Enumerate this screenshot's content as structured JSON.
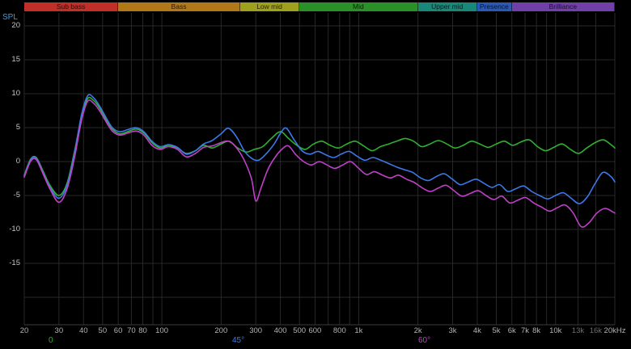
{
  "header": {
    "spl_label": "SPL"
  },
  "bands": [
    {
      "label": "Sub bass",
      "color": "#c03028",
      "from": 20,
      "to": 60
    },
    {
      "label": "Bass",
      "color": "#b07818",
      "from": 60,
      "to": 250
    },
    {
      "label": "Low mid",
      "color": "#9ea01e",
      "from": 250,
      "to": 500
    },
    {
      "label": "Mid",
      "color": "#2a9028",
      "from": 500,
      "to": 2000
    },
    {
      "label": "Upper mid",
      "color": "#198878",
      "from": 2000,
      "to": 4000
    },
    {
      "label": "Presence",
      "color": "#2a58b8",
      "from": 4000,
      "to": 6000
    },
    {
      "label": "Brilliance",
      "color": "#7040a8",
      "from": 6000,
      "to": 20000
    }
  ],
  "legend": [
    {
      "label": "0",
      "color": "#30b030"
    },
    {
      "label": "45°",
      "color": "#3c78e8"
    },
    {
      "label": "60°",
      "color": "#c040c8"
    }
  ],
  "chart_data": {
    "type": "line",
    "title": "",
    "xlabel": "",
    "ylabel": "SPL",
    "x_scale": "log",
    "xlim": [
      20,
      20000
    ],
    "ylim": [
      -24,
      20
    ],
    "grid": true,
    "grid_color": "#282828",
    "axis_line_color": "#3c3c3c",
    "y_ticks": [
      20,
      15,
      10,
      5,
      0,
      -5,
      -10,
      -15
    ],
    "grid_dbs": [
      20,
      15,
      10,
      5,
      0,
      -5,
      -10,
      -15,
      -20
    ],
    "grid_freqs": [
      20,
      30,
      40,
      50,
      60,
      70,
      80,
      90,
      100,
      200,
      300,
      400,
      500,
      600,
      700,
      800,
      900,
      1000,
      2000,
      3000,
      4000,
      5000,
      6000,
      7000,
      8000,
      9000,
      10000,
      13000,
      16000,
      20000
    ],
    "x_ticks": [
      {
        "f": 20,
        "label": "20"
      },
      {
        "f": 30,
        "label": "30"
      },
      {
        "f": 40,
        "label": "40"
      },
      {
        "f": 50,
        "label": "50"
      },
      {
        "f": 60,
        "label": "60"
      },
      {
        "f": 70,
        "label": "70"
      },
      {
        "f": 80,
        "label": "80"
      },
      {
        "f": 100,
        "label": "100"
      },
      {
        "f": 200,
        "label": "200"
      },
      {
        "f": 300,
        "label": "300"
      },
      {
        "f": 400,
        "label": "400"
      },
      {
        "f": 500,
        "label": "500"
      },
      {
        "f": 600,
        "label": "600"
      },
      {
        "f": 800,
        "label": "800"
      },
      {
        "f": 1000,
        "label": "1k"
      },
      {
        "f": 2000,
        "label": "2k"
      },
      {
        "f": 3000,
        "label": "3k"
      },
      {
        "f": 4000,
        "label": "4k"
      },
      {
        "f": 5000,
        "label": "5k"
      },
      {
        "f": 6000,
        "label": "6k"
      },
      {
        "f": 7000,
        "label": "7k"
      },
      {
        "f": 8000,
        "label": "8k"
      },
      {
        "f": 10000,
        "label": "10k"
      },
      {
        "f": 13000,
        "label": "13k",
        "dim": true
      },
      {
        "f": 16000,
        "label": "16k",
        "dim": true
      },
      {
        "f": 20000,
        "label": "20kHz"
      }
    ],
    "series": [
      {
        "name": "0",
        "color": "#30b030",
        "points": [
          [
            20,
            -2.0
          ],
          [
            21.5,
            0.3
          ],
          [
            23,
            0.6
          ],
          [
            25,
            -1.5
          ],
          [
            27,
            -3.5
          ],
          [
            30,
            -5.0
          ],
          [
            33,
            -3.2
          ],
          [
            36,
            1.5
          ],
          [
            39,
            6.5
          ],
          [
            42,
            9.3
          ],
          [
            45,
            9.0
          ],
          [
            48,
            8.0
          ],
          [
            52,
            6.2
          ],
          [
            56,
            4.8
          ],
          [
            61,
            4.1
          ],
          [
            67,
            4.4
          ],
          [
            74,
            4.8
          ],
          [
            81,
            4.2
          ],
          [
            89,
            2.8
          ],
          [
            98,
            2.0
          ],
          [
            108,
            2.4
          ],
          [
            120,
            2.0
          ],
          [
            133,
            1.2
          ],
          [
            148,
            1.6
          ],
          [
            163,
            2.4
          ],
          [
            180,
            2.0
          ],
          [
            200,
            2.6
          ],
          [
            220,
            3.0
          ],
          [
            243,
            2.0
          ],
          [
            268,
            1.4
          ],
          [
            295,
            1.8
          ],
          [
            325,
            2.2
          ],
          [
            360,
            3.4
          ],
          [
            400,
            4.4
          ],
          [
            440,
            3.4
          ],
          [
            485,
            2.4
          ],
          [
            535,
            1.8
          ],
          [
            590,
            2.6
          ],
          [
            650,
            3.0
          ],
          [
            715,
            2.4
          ],
          [
            790,
            2.0
          ],
          [
            870,
            2.6
          ],
          [
            960,
            3.0
          ],
          [
            1060,
            2.3
          ],
          [
            1170,
            1.6
          ],
          [
            1290,
            2.2
          ],
          [
            1420,
            2.6
          ],
          [
            1560,
            3.0
          ],
          [
            1720,
            3.4
          ],
          [
            1900,
            3.0
          ],
          [
            2090,
            2.2
          ],
          [
            2300,
            2.6
          ],
          [
            2540,
            3.1
          ],
          [
            2800,
            2.6
          ],
          [
            3080,
            2.0
          ],
          [
            3400,
            2.4
          ],
          [
            3740,
            3.0
          ],
          [
            4120,
            2.6
          ],
          [
            4540,
            2.1
          ],
          [
            5000,
            2.6
          ],
          [
            5500,
            3.0
          ],
          [
            6060,
            2.4
          ],
          [
            6680,
            2.9
          ],
          [
            7350,
            3.2
          ],
          [
            8100,
            2.2
          ],
          [
            8900,
            1.6
          ],
          [
            9800,
            2.1
          ],
          [
            10800,
            2.6
          ],
          [
            11900,
            1.8
          ],
          [
            13100,
            1.2
          ],
          [
            14400,
            2.0
          ],
          [
            15900,
            2.8
          ],
          [
            17500,
            3.2
          ],
          [
            19300,
            2.4
          ],
          [
            20000,
            2.0
          ]
        ]
      },
      {
        "name": "45°",
        "color": "#3c78e8",
        "points": [
          [
            20,
            -2.1
          ],
          [
            21.5,
            0.2
          ],
          [
            23,
            0.5
          ],
          [
            25,
            -1.7
          ],
          [
            27,
            -3.8
          ],
          [
            30,
            -5.4
          ],
          [
            33,
            -3.5
          ],
          [
            36,
            1.2
          ],
          [
            39,
            6.8
          ],
          [
            42,
            9.7
          ],
          [
            45,
            9.4
          ],
          [
            48,
            8.3
          ],
          [
            52,
            6.5
          ],
          [
            56,
            5.0
          ],
          [
            61,
            4.4
          ],
          [
            67,
            4.7
          ],
          [
            74,
            5.0
          ],
          [
            81,
            4.4
          ],
          [
            89,
            3.0
          ],
          [
            98,
            2.2
          ],
          [
            108,
            2.5
          ],
          [
            120,
            2.1
          ],
          [
            133,
            1.1
          ],
          [
            148,
            1.6
          ],
          [
            163,
            2.6
          ],
          [
            180,
            3.1
          ],
          [
            200,
            4.1
          ],
          [
            218,
            4.9
          ],
          [
            240,
            3.6
          ],
          [
            262,
            1.6
          ],
          [
            285,
            0.5
          ],
          [
            310,
            0.2
          ],
          [
            340,
            1.2
          ],
          [
            372,
            2.6
          ],
          [
            405,
            4.4
          ],
          [
            430,
            4.9
          ],
          [
            470,
            3.2
          ],
          [
            515,
            1.6
          ],
          [
            565,
            1.1
          ],
          [
            620,
            1.5
          ],
          [
            680,
            1.0
          ],
          [
            745,
            0.6
          ],
          [
            815,
            1.1
          ],
          [
            895,
            1.5
          ],
          [
            980,
            0.8
          ],
          [
            1075,
            0.2
          ],
          [
            1180,
            0.6
          ],
          [
            1295,
            0.2
          ],
          [
            1420,
            -0.3
          ],
          [
            1560,
            -0.8
          ],
          [
            1710,
            -1.2
          ],
          [
            1880,
            -1.6
          ],
          [
            2060,
            -2.4
          ],
          [
            2260,
            -2.8
          ],
          [
            2480,
            -2.2
          ],
          [
            2720,
            -1.8
          ],
          [
            2990,
            -2.6
          ],
          [
            3280,
            -3.4
          ],
          [
            3600,
            -3.0
          ],
          [
            3950,
            -2.6
          ],
          [
            4330,
            -3.2
          ],
          [
            4750,
            -3.8
          ],
          [
            5210,
            -3.4
          ],
          [
            5720,
            -4.4
          ],
          [
            6280,
            -4.0
          ],
          [
            6890,
            -3.6
          ],
          [
            7560,
            -4.4
          ],
          [
            8290,
            -5.0
          ],
          [
            9100,
            -5.5
          ],
          [
            9980,
            -5.0
          ],
          [
            10950,
            -4.6
          ],
          [
            12000,
            -5.4
          ],
          [
            13200,
            -6.2
          ],
          [
            14500,
            -5.2
          ],
          [
            15900,
            -3.2
          ],
          [
            17400,
            -1.6
          ],
          [
            19100,
            -2.2
          ],
          [
            20000,
            -3.0
          ]
        ]
      },
      {
        "name": "60°",
        "color": "#c040c8",
        "points": [
          [
            20,
            -2.3
          ],
          [
            21.5,
            0.0
          ],
          [
            23,
            0.3
          ],
          [
            25,
            -1.9
          ],
          [
            27,
            -4.0
          ],
          [
            30,
            -6.0
          ],
          [
            33,
            -4.0
          ],
          [
            36,
            0.6
          ],
          [
            39,
            6.0
          ],
          [
            42,
            8.9
          ],
          [
            45,
            8.6
          ],
          [
            48,
            7.6
          ],
          [
            52,
            5.9
          ],
          [
            56,
            4.5
          ],
          [
            61,
            3.9
          ],
          [
            67,
            4.2
          ],
          [
            74,
            4.5
          ],
          [
            81,
            3.9
          ],
          [
            89,
            2.4
          ],
          [
            98,
            1.8
          ],
          [
            108,
            2.2
          ],
          [
            120,
            1.8
          ],
          [
            133,
            0.7
          ],
          [
            148,
            1.2
          ],
          [
            163,
            2.1
          ],
          [
            180,
            2.3
          ],
          [
            200,
            2.8
          ],
          [
            218,
            3.0
          ],
          [
            240,
            2.0
          ],
          [
            262,
            0.2
          ],
          [
            285,
            -2.5
          ],
          [
            300,
            -5.8
          ],
          [
            318,
            -4.0
          ],
          [
            345,
            -1.2
          ],
          [
            375,
            0.6
          ],
          [
            410,
            1.9
          ],
          [
            440,
            2.3
          ],
          [
            480,
            1.0
          ],
          [
            525,
            0.0
          ],
          [
            575,
            -0.5
          ],
          [
            630,
            0.0
          ],
          [
            690,
            -0.5
          ],
          [
            755,
            -1.0
          ],
          [
            830,
            -0.5
          ],
          [
            910,
            0.0
          ],
          [
            1000,
            -1.0
          ],
          [
            1095,
            -1.9
          ],
          [
            1200,
            -1.5
          ],
          [
            1320,
            -2.0
          ],
          [
            1450,
            -2.4
          ],
          [
            1590,
            -2.0
          ],
          [
            1750,
            -2.6
          ],
          [
            1920,
            -3.1
          ],
          [
            2110,
            -3.9
          ],
          [
            2310,
            -4.4
          ],
          [
            2540,
            -3.9
          ],
          [
            2780,
            -3.5
          ],
          [
            3050,
            -4.3
          ],
          [
            3350,
            -5.1
          ],
          [
            3680,
            -4.7
          ],
          [
            4040,
            -4.3
          ],
          [
            4430,
            -5.0
          ],
          [
            4860,
            -5.6
          ],
          [
            5330,
            -5.1
          ],
          [
            5850,
            -6.1
          ],
          [
            6420,
            -5.7
          ],
          [
            7050,
            -5.3
          ],
          [
            7740,
            -6.1
          ],
          [
            8490,
            -6.7
          ],
          [
            9310,
            -7.3
          ],
          [
            10200,
            -6.8
          ],
          [
            11200,
            -6.4
          ],
          [
            12300,
            -7.6
          ],
          [
            13500,
            -9.6
          ],
          [
            14800,
            -9.0
          ],
          [
            16200,
            -7.6
          ],
          [
            17800,
            -6.9
          ],
          [
            19500,
            -7.4
          ],
          [
            20000,
            -7.6
          ]
        ]
      }
    ]
  }
}
